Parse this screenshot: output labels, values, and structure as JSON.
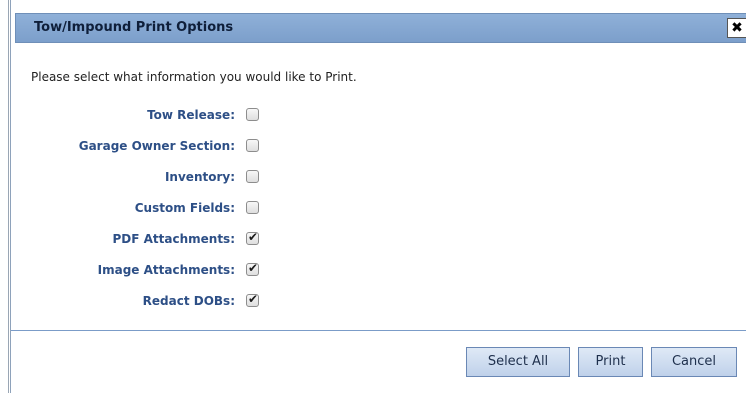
{
  "dialog": {
    "title": "Tow/Impound Print Options",
    "close_glyph": "✖",
    "instructions": "Please select what information you would like to Print."
  },
  "options": [
    {
      "label": "Tow Release:",
      "checked": false
    },
    {
      "label": "Garage Owner Section:",
      "checked": false
    },
    {
      "label": "Inventory:",
      "checked": false
    },
    {
      "label": "Custom Fields:",
      "checked": false
    },
    {
      "label": "PDF Attachments:",
      "checked": true
    },
    {
      "label": "Image Attachments:",
      "checked": true
    },
    {
      "label": "Redact DOBs:",
      "checked": true
    }
  ],
  "buttons": {
    "select_all": "Select All",
    "print": "Print",
    "cancel": "Cancel"
  },
  "colors": {
    "titlebar": "#8fb0d8",
    "label": "#2d4f86",
    "button_border": "#6a88b5"
  },
  "icons": {
    "close": "close-icon",
    "check": "checkmark-icon"
  }
}
